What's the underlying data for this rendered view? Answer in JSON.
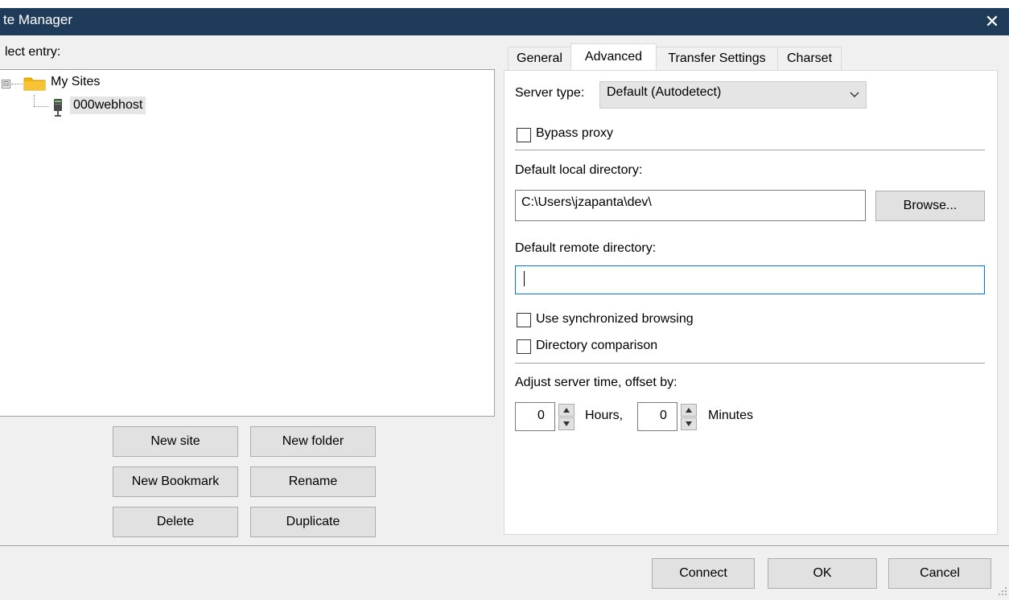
{
  "window": {
    "title": "te Manager",
    "close_glyph": "✕"
  },
  "left": {
    "select_entry_label": "lect entry:",
    "tree": [
      {
        "label": "My Sites",
        "icon": "folder-icon",
        "expander": "⊟"
      },
      {
        "label": "000webhost",
        "icon": "server-icon",
        "selected": true
      }
    ],
    "buttons": {
      "new_site": "New site",
      "new_folder": "New folder",
      "new_bookmark": "New Bookmark",
      "rename": "Rename",
      "delete": "Delete",
      "duplicate": "Duplicate"
    }
  },
  "tabs": [
    {
      "label": "General"
    },
    {
      "label": "Advanced",
      "active": true
    },
    {
      "label": "Transfer Settings"
    },
    {
      "label": "Charset"
    }
  ],
  "advanced": {
    "server_type_label": "Server type:",
    "server_type_value": "Default (Autodetect)",
    "bypass_proxy_label": "Bypass proxy",
    "bypass_proxy_checked": false,
    "default_local_dir_label": "Default local directory:",
    "default_local_dir_value": "C:\\Users\\jzapanta\\dev\\",
    "browse_label": "Browse...",
    "default_remote_dir_label": "Default remote directory:",
    "default_remote_dir_value": "",
    "sync_browsing_label": "Use synchronized browsing",
    "sync_browsing_checked": false,
    "dir_comparison_label": "Directory comparison",
    "dir_comparison_checked": false,
    "adjust_time_label": "Adjust server time, offset by:",
    "hours_value": "0",
    "hours_label": "Hours,",
    "minutes_value": "0",
    "minutes_label": "Minutes"
  },
  "footer": {
    "connect": "Connect",
    "ok": "OK",
    "cancel": "Cancel"
  },
  "colors": {
    "titlebar": "#1f3b5a",
    "focus_border": "#0078d7",
    "folder": "#f4b400"
  }
}
